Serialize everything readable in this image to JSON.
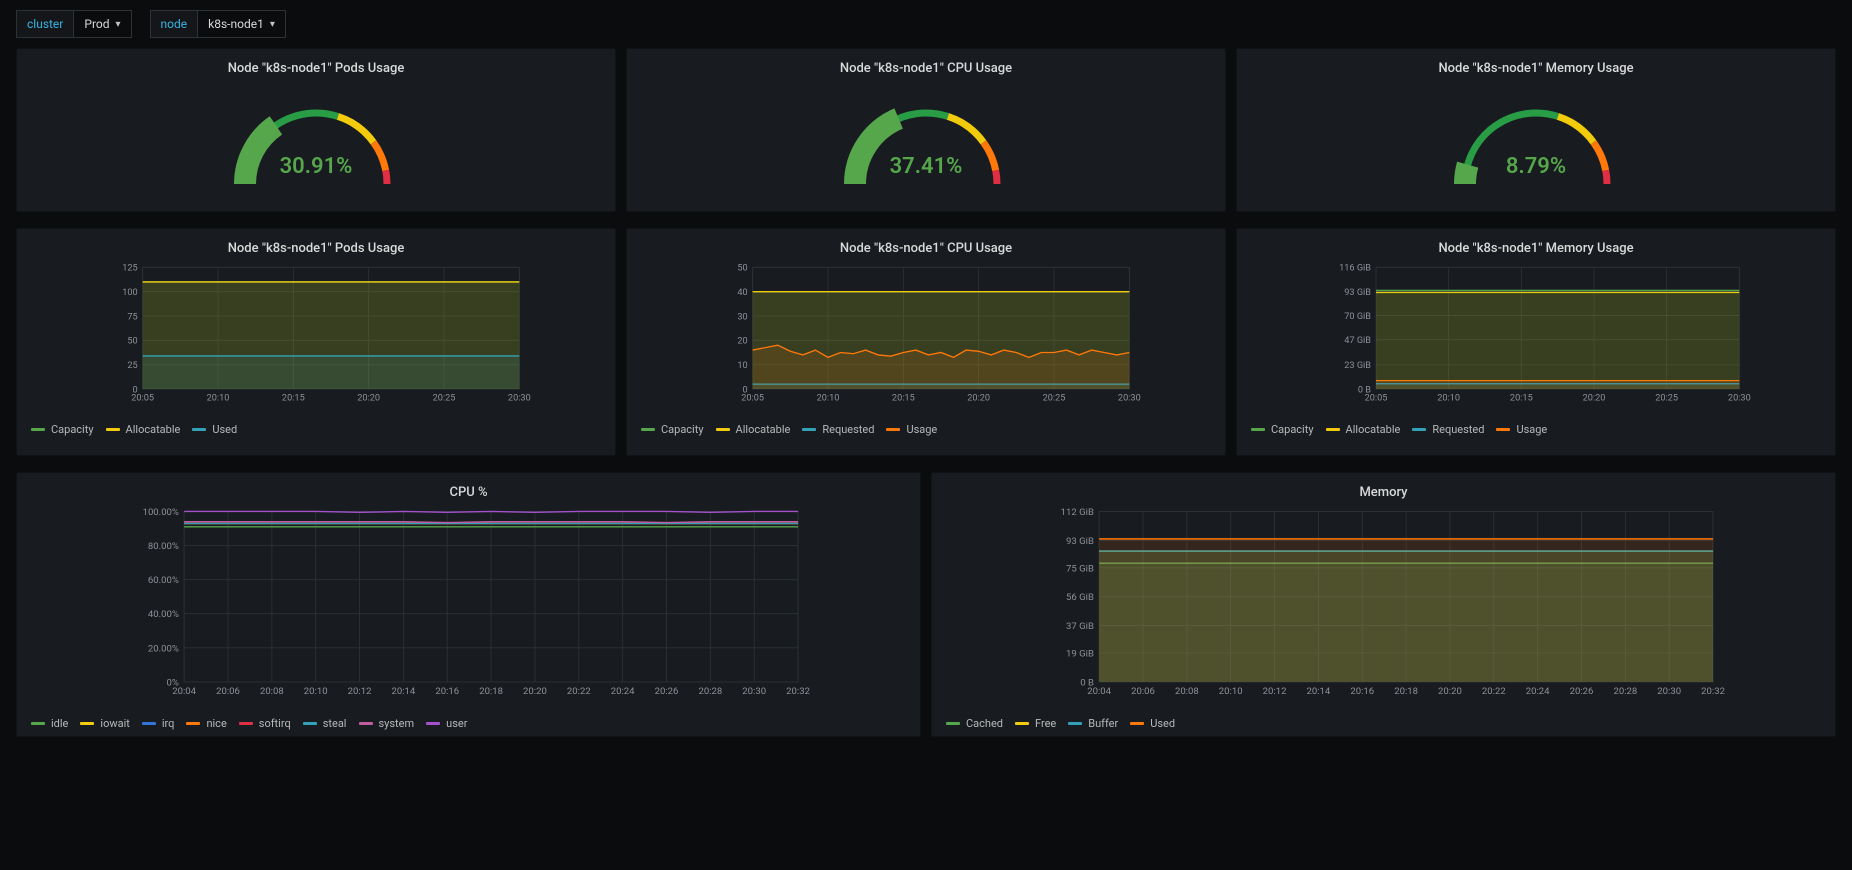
{
  "toolbar": {
    "cluster_label": "cluster",
    "cluster_value": "Prod",
    "node_label": "node",
    "node_value": "k8s-node1"
  },
  "colors": {
    "green": "#56A64B",
    "yellow": "#F2CC0C",
    "orange": "#FF780A",
    "red": "#E02F44",
    "teal": "#5794F2",
    "cyan": "#33a2b8",
    "blue": "#3274D9",
    "purple": "#A352CC",
    "magenta": "#c15c9e"
  },
  "gauges": [
    {
      "title": "Node \"k8s-node1\" Pods Usage",
      "value": 30.91,
      "display": "30.91%"
    },
    {
      "title": "Node \"k8s-node1\" CPU Usage",
      "value": 37.41,
      "display": "37.41%"
    },
    {
      "title": "Node \"k8s-node1\" Memory Usage",
      "value": 8.79,
      "display": "8.79%"
    }
  ],
  "ts_panels": [
    {
      "title": "Node \"k8s-node1\" Pods Usage"
    },
    {
      "title": "Node \"k8s-node1\" CPU Usage"
    },
    {
      "title": "Node \"k8s-node1\" Memory Usage"
    }
  ],
  "wide_panels": [
    {
      "title": "CPU %"
    },
    {
      "title": "Memory"
    }
  ],
  "chart_data": [
    {
      "type": "line",
      "panel": "Node \"k8s-node1\" Pods Usage",
      "x": [
        "20:05",
        "20:10",
        "20:15",
        "20:20",
        "20:25",
        "20:30"
      ],
      "ylim": [
        0,
        125
      ],
      "yticks": [
        0,
        25,
        50,
        75,
        100,
        125
      ],
      "series": [
        {
          "name": "Capacity",
          "color": "#56A64B",
          "values": [
            110,
            110,
            110,
            110,
            110,
            110
          ],
          "area": true
        },
        {
          "name": "Allocatable",
          "color": "#F2CC0C",
          "values": [
            110,
            110,
            110,
            110,
            110,
            110
          ],
          "area": true
        },
        {
          "name": "Used",
          "color": "#33a2b8",
          "values": [
            34,
            34,
            34,
            34,
            34,
            34
          ],
          "area": true
        }
      ]
    },
    {
      "type": "line",
      "panel": "Node \"k8s-node1\" CPU Usage",
      "x": [
        "20:05",
        "20:10",
        "20:15",
        "20:20",
        "20:25",
        "20:30"
      ],
      "ylim": [
        0,
        50
      ],
      "yticks": [
        0,
        10,
        20,
        30,
        40,
        50
      ],
      "series": [
        {
          "name": "Capacity",
          "color": "#56A64B",
          "values": [
            40,
            40,
            40,
            40,
            40,
            40
          ],
          "area": true
        },
        {
          "name": "Allocatable",
          "color": "#F2CC0C",
          "values": [
            40,
            40,
            40,
            40,
            40,
            40
          ],
          "area": true
        },
        {
          "name": "Requested",
          "color": "#33a2b8",
          "values": [
            2,
            2,
            2,
            2,
            2,
            2
          ],
          "area": true
        },
        {
          "name": "Usage",
          "color": "#FF780A",
          "values": [
            16,
            17,
            18,
            15.5,
            14,
            16,
            13,
            15,
            14.5,
            16,
            14,
            13.5,
            15,
            16,
            14,
            15,
            13,
            16,
            15.5,
            14,
            16,
            15,
            13,
            15,
            15,
            16,
            14,
            16,
            15,
            14,
            15
          ],
          "area": true,
          "dense": true
        }
      ]
    },
    {
      "type": "line",
      "panel": "Node \"k8s-node1\" Memory Usage",
      "x": [
        "20:05",
        "20:10",
        "20:15",
        "20:20",
        "20:25",
        "20:30"
      ],
      "ylim": [
        0,
        116
      ],
      "yticks_labels": [
        "0 B",
        "23 GiB",
        "47 GiB",
        "70 GiB",
        "93 GiB",
        "116 GiB"
      ],
      "yticks": [
        0,
        23,
        47,
        70,
        93,
        116
      ],
      "series": [
        {
          "name": "Capacity",
          "color": "#56A64B",
          "values": [
            94,
            94,
            94,
            94,
            94,
            94
          ],
          "area": true
        },
        {
          "name": "Allocatable",
          "color": "#F2CC0C",
          "values": [
            92,
            92,
            92,
            92,
            92,
            92
          ],
          "area": true
        },
        {
          "name": "Requested",
          "color": "#33a2b8",
          "values": [
            5,
            5,
            5,
            5,
            5,
            5
          ],
          "area": true
        },
        {
          "name": "Usage",
          "color": "#FF780A",
          "values": [
            8,
            8,
            8,
            8,
            8,
            8
          ],
          "area": true
        }
      ]
    },
    {
      "type": "line",
      "panel": "CPU %",
      "x": [
        "20:04",
        "20:06",
        "20:08",
        "20:10",
        "20:12",
        "20:14",
        "20:16",
        "20:18",
        "20:20",
        "20:22",
        "20:24",
        "20:26",
        "20:28",
        "20:30",
        "20:32"
      ],
      "ylim": [
        0,
        100
      ],
      "yticks": [
        0,
        20,
        40,
        60,
        80,
        100
      ],
      "yticks_labels": [
        "0%",
        "20.00%",
        "40.00%",
        "60.00%",
        "80.00%",
        "100.00%"
      ],
      "series": [
        {
          "name": "idle",
          "color": "#56A64B",
          "values": [
            91,
            91,
            91,
            91,
            91,
            91,
            91,
            91,
            91,
            91,
            91,
            91,
            91,
            91,
            91
          ]
        },
        {
          "name": "iowait",
          "color": "#F2CC0C",
          "values": [
            93,
            93,
            93,
            93,
            93,
            93,
            93,
            93,
            93,
            93,
            93,
            93,
            93,
            93,
            93
          ]
        },
        {
          "name": "irq",
          "color": "#3274D9",
          "values": [
            93,
            93,
            93,
            93,
            93,
            93,
            93,
            93,
            93,
            93,
            93,
            93,
            93,
            93,
            93
          ]
        },
        {
          "name": "nice",
          "color": "#FF780A",
          "values": [
            93,
            93,
            93,
            93,
            93,
            93,
            93,
            93,
            93,
            93,
            93,
            93,
            93,
            93,
            93
          ]
        },
        {
          "name": "softirq",
          "color": "#E02F44",
          "values": [
            93,
            93,
            93,
            93,
            93,
            93,
            93,
            93,
            93,
            93,
            93,
            93,
            93,
            93,
            93
          ]
        },
        {
          "name": "steal",
          "color": "#33a2b8",
          "values": [
            93,
            93,
            93,
            93,
            93,
            93,
            93,
            93,
            93,
            93,
            93,
            93,
            93,
            93,
            93
          ]
        },
        {
          "name": "system",
          "color": "#c15c9e",
          "values": [
            94,
            94,
            94,
            94,
            94,
            94,
            93.5,
            94,
            94,
            94,
            94,
            93.5,
            94,
            94,
            94
          ]
        },
        {
          "name": "user",
          "color": "#A352CC",
          "values": [
            100,
            100,
            100,
            100,
            99.5,
            100,
            99.5,
            100,
            99.5,
            100,
            100,
            100,
            99.5,
            100,
            100
          ]
        }
      ]
    },
    {
      "type": "line",
      "panel": "Memory",
      "x": [
        "20:04",
        "20:06",
        "20:08",
        "20:10",
        "20:12",
        "20:14",
        "20:16",
        "20:18",
        "20:20",
        "20:22",
        "20:24",
        "20:26",
        "20:28",
        "20:30",
        "20:32"
      ],
      "ylim": [
        0,
        112
      ],
      "yticks": [
        0,
        19,
        37,
        56,
        75,
        93,
        112
      ],
      "yticks_labels": [
        "0 B",
        "19 GiB",
        "37 GiB",
        "56 GiB",
        "75 GiB",
        "93 GiB",
        "112 GiB"
      ],
      "series": [
        {
          "name": "Cached",
          "color": "#56A64B",
          "values": [
            78,
            78,
            78,
            78,
            78,
            78,
            78,
            78,
            78,
            78,
            78,
            78,
            78,
            78,
            78
          ],
          "area": true
        },
        {
          "name": "Free",
          "color": "#F2CC0C",
          "values": [
            86,
            86,
            86,
            86,
            86,
            86,
            86,
            86,
            86,
            86,
            86,
            86,
            86,
            86,
            86
          ],
          "area": true
        },
        {
          "name": "Buffer",
          "color": "#33a2b8",
          "values": [
            86,
            86,
            86,
            86,
            86,
            86,
            86,
            86,
            86,
            86,
            86,
            86,
            86,
            86,
            86
          ],
          "area": true
        },
        {
          "name": "Used",
          "color": "#FF780A",
          "values": [
            94,
            94,
            94,
            94,
            94,
            94,
            94,
            94,
            94,
            94,
            94,
            94,
            94,
            94,
            94
          ],
          "area": true
        }
      ]
    }
  ]
}
